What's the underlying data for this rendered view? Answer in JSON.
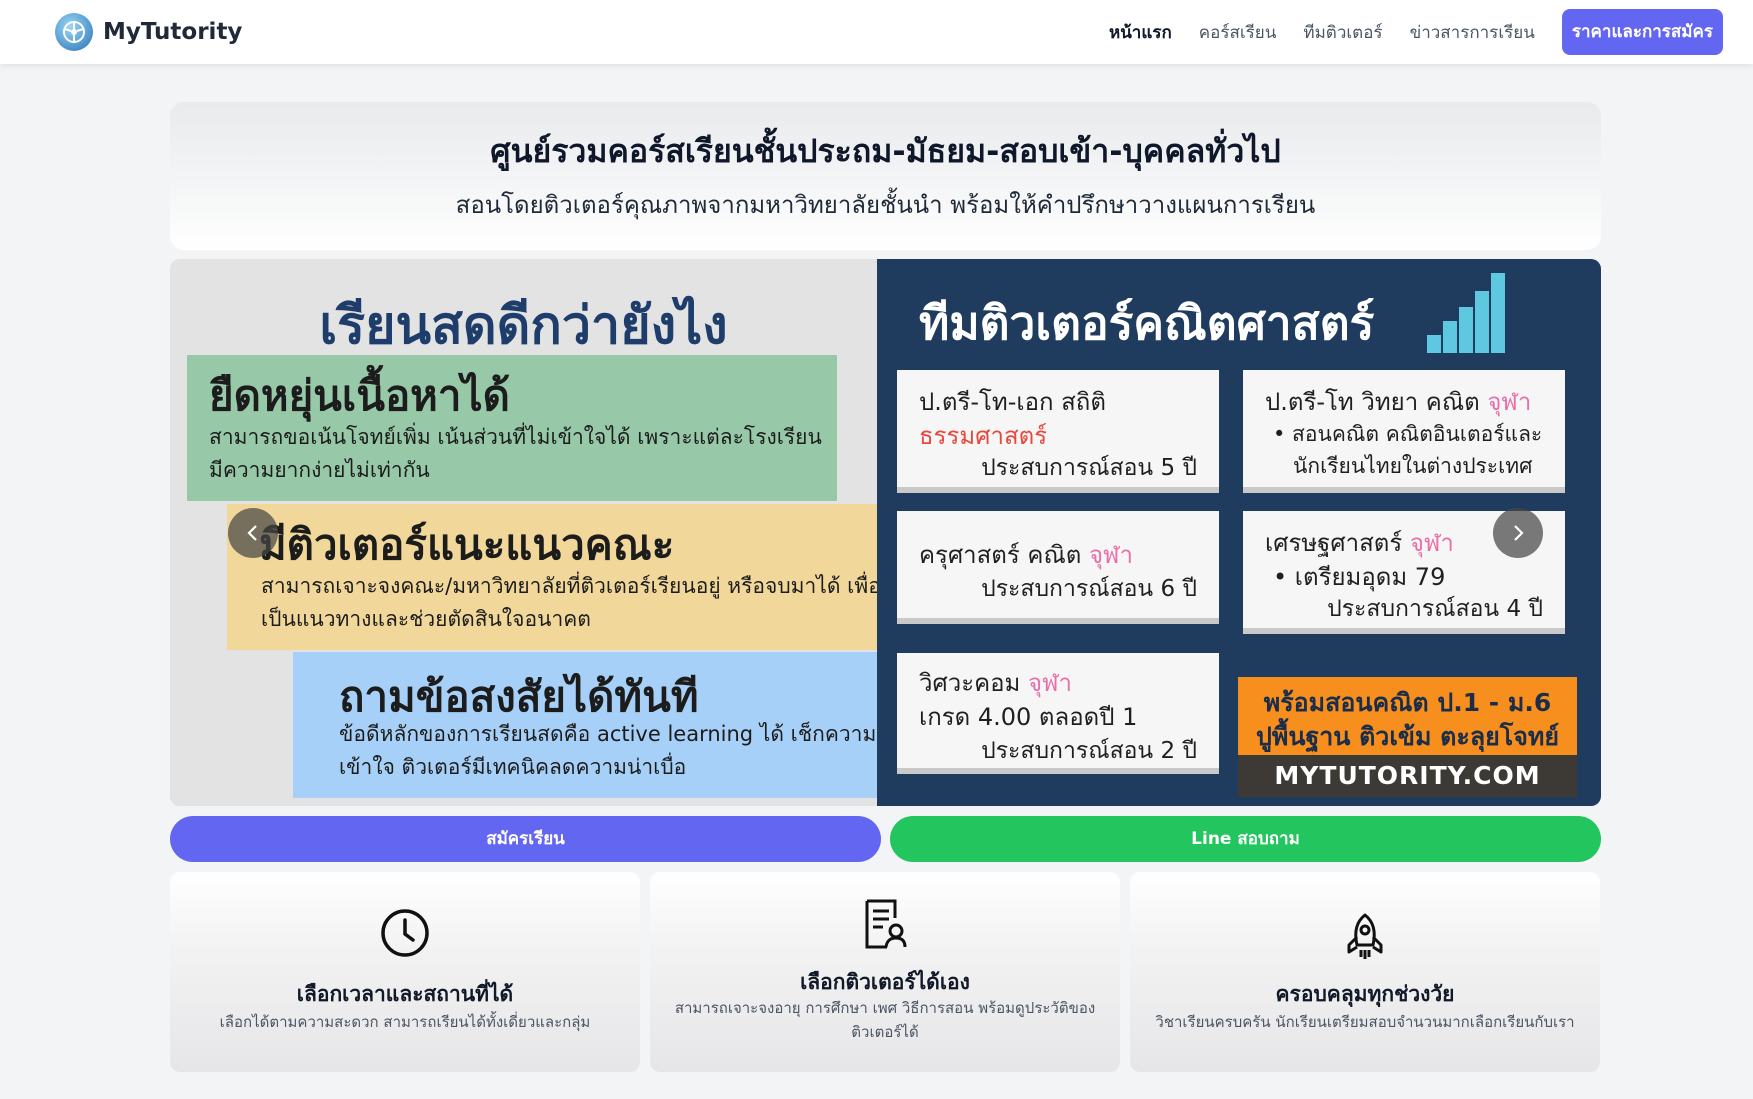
{
  "brand": {
    "name": "MyTutority"
  },
  "nav": {
    "items": [
      {
        "label": "หน้าแรก"
      },
      {
        "label": "คอร์สเรียน"
      },
      {
        "label": "ทีมติวเตอร์"
      },
      {
        "label": "ข่าวสารการเรียน"
      }
    ],
    "cta_label": "ราคาและการสมัคร"
  },
  "hero": {
    "title": "ศูนย์รวมคอร์สเรียนชั้นประถม-มัธยม-สอบเข้า-บุคคลทั่วไป",
    "subtitle": "สอนโดยติวเตอร์คุณภาพจากมหาวิทยาลัยชั้นนำ พร้อมให้คำปรึกษาวางแผนการเรียน"
  },
  "slides": {
    "left": {
      "title": "เรียนสดดีกว่ายังไง",
      "boxes": [
        {
          "heading": "ยืดหยุ่นเนื้อหาได้",
          "text": "สามารถขอเน้นโจทย์เพิ่ม เน้นส่วนที่ไม่เข้าใจได้ เพราะแต่ละโรงเรียนมีความยากง่ายไม่เท่ากัน"
        },
        {
          "heading": "มีติวเตอร์แนะแนวคณะ",
          "text": "สามารถเจาะจงคณะ/มหาวิทยาลัยที่ติวเตอร์เรียนอยู่ หรือจบมาได้ เพื่อเป็นแนวทางและช่วยตัดสินใจอนาคต"
        },
        {
          "heading": "ถามข้อสงสัยได้ทันที",
          "text": "ข้อดีหลักของการเรียนสดคือ active learning ได้ เช็กความเข้าใจ ติวเตอร์มีเทคนิคลดความน่าเบื่อ"
        }
      ]
    },
    "right": {
      "title": "ทีมติวเตอร์คณิตศาสตร์",
      "cards": [
        {
          "line1": "ป.ตรี-โท-เอก สถิติ",
          "line2": "ธรรมศาสตร์",
          "exp": "ประสบการณ์สอน 5 ปี"
        },
        {
          "line1": "ป.ตรี-โท วิทยา คณิต",
          "tag": "จุฬา",
          "bullet": "• สอนคณิต คณิตอินเตอร์และ",
          "bullet2": "นักเรียนไทยในต่างประเทศ"
        },
        {
          "line1": "ครุศาสตร์ คณิต",
          "tag": "จุฬา",
          "exp": "ประสบการณ์สอน 6 ปี"
        },
        {
          "line1": "เศรษฐศาสตร์",
          "tag": "จุฬา",
          "bullet": "• เตรียมอุดม 79",
          "exp": "ประสบการณ์สอน 4 ปี"
        },
        {
          "line1": "วิศวะคอม",
          "tag": "จุฬา",
          "line2": "เกรด 4.00 ตลอดปี 1",
          "exp": "ประสบการณ์สอน 2 ปี"
        }
      ],
      "promo": {
        "line1": "พร้อมสอนคณิต ป.1 - ม.6",
        "line2": "ปูพื้นฐาน ติวเข้ม ตะลุยโจทย์",
        "site": "MYTUTORITY.COM"
      }
    }
  },
  "actions": {
    "apply_label": "สมัครเรียน",
    "line_label": "Line สอบถาม"
  },
  "features": [
    {
      "icon": "clock-icon",
      "title": "เลือกเวลาและสถานที่ได้",
      "desc": "เลือกได้ตามความสะดวก สามารถเรียนได้ทั้งเดี่ยวและกลุ่ม"
    },
    {
      "icon": "tutor-profile-icon",
      "title": "เลือกติวเตอร์ได้เอง",
      "desc": "สามารถเจาะจงอายุ การศึกษา เพศ วิธีการสอน พร้อมดูประวัติของติวเตอร์ได้"
    },
    {
      "icon": "rocket-icon",
      "title": "ครอบคลุมทุกช่วงวัย",
      "desc": "วิชาเรียนครบครัน นักเรียนเตรียมสอบจำนวนมากเลือกเรียนกับเรา"
    }
  ],
  "colors": {
    "primary": "#6366f1",
    "line_green": "#22c55e",
    "slide_navy": "#1f3b5e"
  }
}
